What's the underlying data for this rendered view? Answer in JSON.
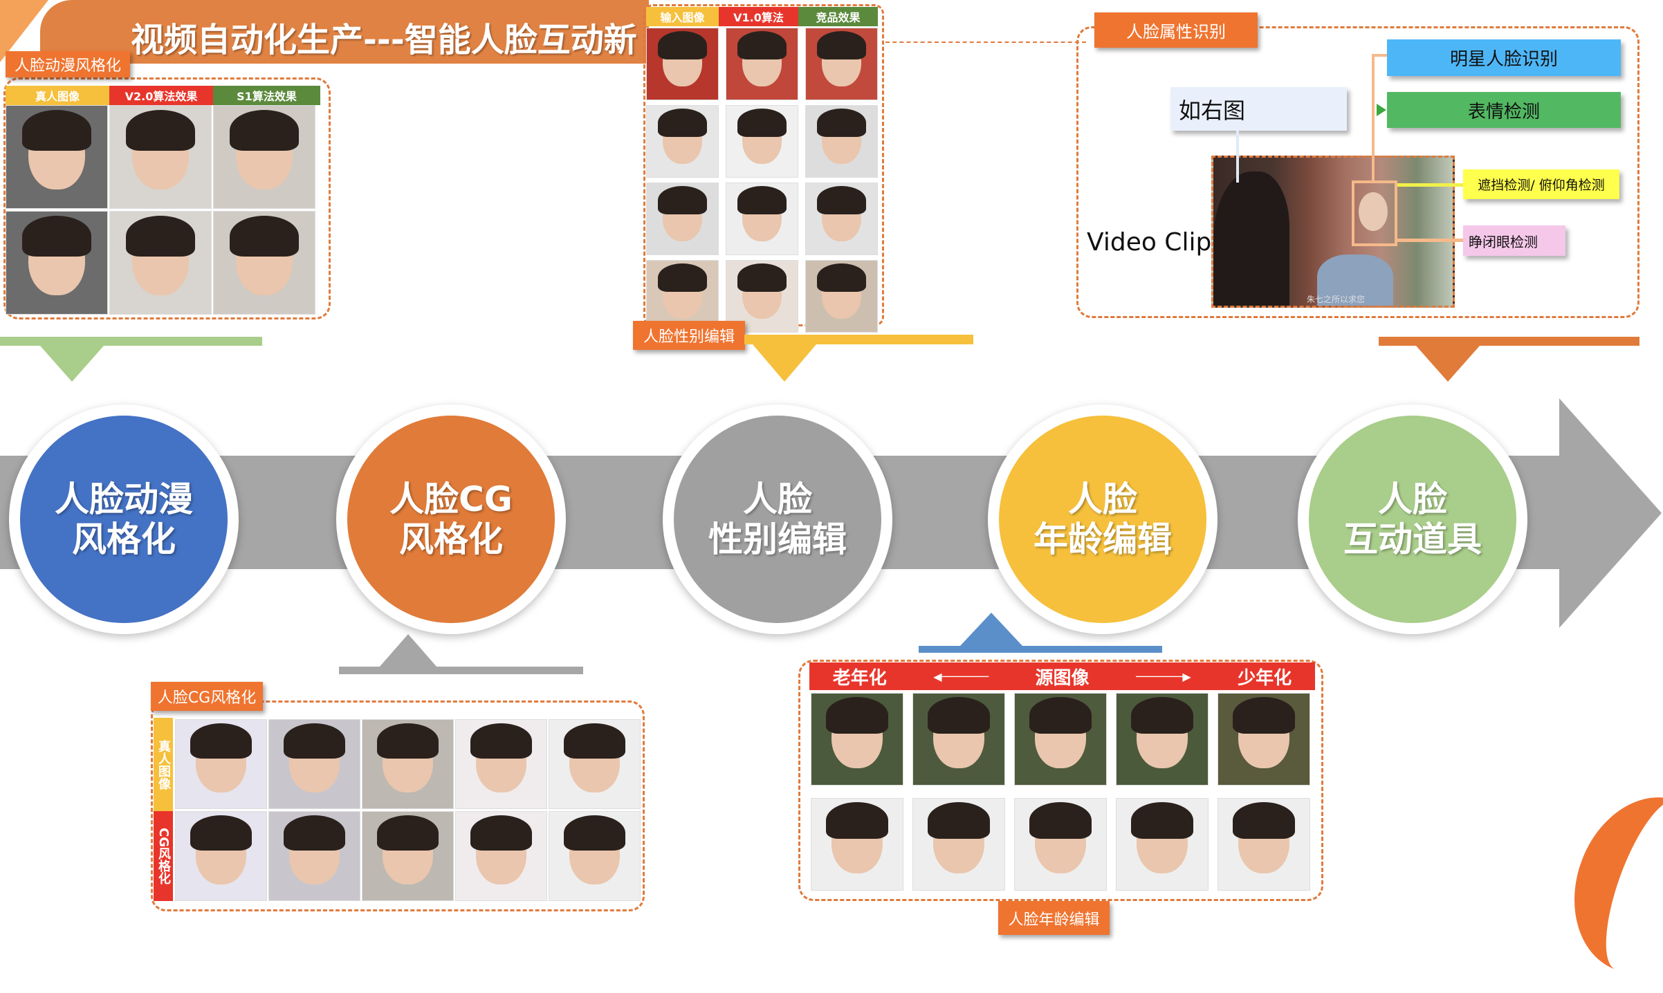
{
  "title": "视频自动化生产---智能人脸互动新",
  "anime": {
    "tag": "人脸动漫风格化",
    "headers": [
      "真人图像",
      "V2.0算法效果",
      "S1算法效果"
    ]
  },
  "gender": {
    "tag": "人脸性别编辑",
    "headers": [
      "输入图像",
      "V1.0算法",
      "竞品效果"
    ]
  },
  "attr": {
    "tag": "人脸属性识别",
    "star": "明星人脸识别",
    "expression": "表情检测",
    "see_right": "如右图",
    "video_clip": "Video Clip",
    "occlusion": "遮挡检测/ 俯仰角检测",
    "eyes": "睁闭眼检测",
    "subtitle": "朱七之所以求您"
  },
  "stages": [
    {
      "line1": "人脸动漫",
      "line2": "风格化",
      "color": "#4472c4"
    },
    {
      "line1": "人脸CG",
      "line2": "风格化",
      "color": "#e07b39"
    },
    {
      "line1": "人脸",
      "line2": "性别编辑",
      "color": "#a0a0a0"
    },
    {
      "line1": "人脸",
      "line2": "年龄编辑",
      "color": "#f6c03c"
    },
    {
      "line1": "人脸",
      "line2": "互动道具",
      "color": "#a9cd8a"
    }
  ],
  "cg": {
    "tag": "人脸CG风格化",
    "row_labels": [
      "真人图像",
      "CG风格化"
    ]
  },
  "age": {
    "tag": "人脸年龄编辑",
    "older": "老年化",
    "source": "源图像",
    "younger": "少年化",
    "left_arrow": "◀───────",
    "right_arrow": "───────▶"
  }
}
